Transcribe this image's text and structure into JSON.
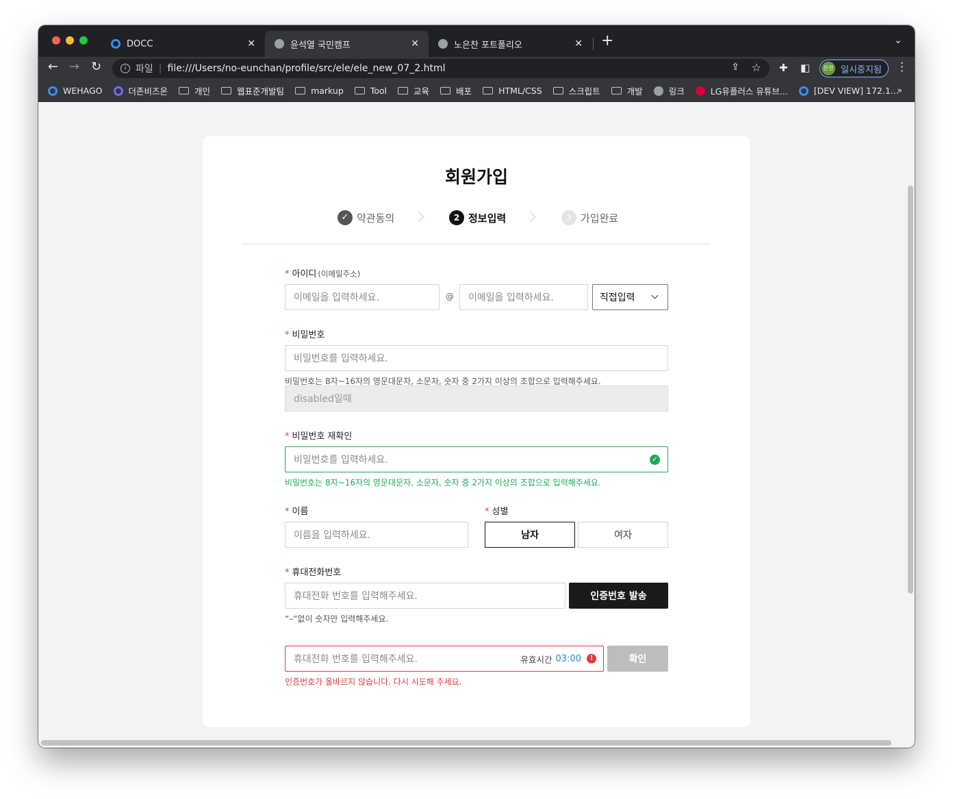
{
  "browser": {
    "tabs": [
      {
        "label": "DOCC",
        "close": "✕"
      },
      {
        "label": "윤석열 국민캠프",
        "close": "✕"
      },
      {
        "label": "노은찬 포트폴리오",
        "close": "✕"
      }
    ],
    "new_tab": "+",
    "tab_menu": "⌄",
    "nav": {
      "back": "←",
      "forward": "→",
      "reload": "↻"
    },
    "address": {
      "info_icon": "i",
      "scheme_label": "파일",
      "url": "file:///Users/no-eunchan/profile/src/ele/ele_new_07_2.html"
    },
    "profile": {
      "avatar": "은찬",
      "label": "일시중지됨"
    },
    "menu": "⋮",
    "bookmarks": [
      {
        "label": "WEHAGO",
        "icon": "ring"
      },
      {
        "label": "더존비즈온",
        "icon": "ring"
      },
      {
        "label": "개인",
        "icon": "folder"
      },
      {
        "label": "웹표준개발팀",
        "icon": "folder"
      },
      {
        "label": "markup",
        "icon": "folder"
      },
      {
        "label": "Tool",
        "icon": "folder"
      },
      {
        "label": "교육",
        "icon": "folder"
      },
      {
        "label": "배포",
        "icon": "folder"
      },
      {
        "label": "HTML/CSS",
        "icon": "folder"
      },
      {
        "label": "스크립트",
        "icon": "folder"
      },
      {
        "label": "개발",
        "icon": "folder"
      },
      {
        "label": "링크",
        "icon": "globe"
      },
      {
        "label": "LG유플러스 유튜브...",
        "icon": "lg"
      },
      {
        "label": "[DEV VIEW] 172.1...",
        "icon": "ring"
      }
    ],
    "bookmarks_more": "»"
  },
  "form": {
    "title": "회원가입",
    "steps": [
      {
        "num": "✓",
        "label": "약관동의"
      },
      {
        "num": "2",
        "label": "정보입력"
      },
      {
        "num": "3",
        "label": "가입완료"
      }
    ],
    "id": {
      "required": "*",
      "label": "아이디",
      "sub": "(이메일주소)",
      "local_placeholder": "이메일을 입력하세요.",
      "at": "@",
      "domain_placeholder": "이메일을 입력하세요.",
      "domain_select": "직접입력"
    },
    "password": {
      "required": "*",
      "label": "비밀번호",
      "placeholder": "비밀번호를 입력하세요.",
      "help": "비밀번호는 8자~16자의 영문대문자, 소문자, 숫자 중 2가지 이상의 조합으로 입력해주세요.",
      "disabled_value": "disabled일때"
    },
    "password_confirm": {
      "required": "*",
      "label": "비밀번호 재확인",
      "placeholder": "비밀번호를 입력하세요.",
      "help": "비밀번호는 8자~16자의 영문대문자, 소문자, 숫자 중 2가지 이상의 조합으로 입력해주세요."
    },
    "name": {
      "required": "*",
      "label": "이름",
      "placeholder": "이름을 입력하세요."
    },
    "gender": {
      "required": "*",
      "label": "성별",
      "male": "남자",
      "female": "여자",
      "selected": "남자"
    },
    "phone": {
      "required": "*",
      "label": "휴대전화번호",
      "placeholder": "휴대전화 번호를 입력해주세요.",
      "send_button": "인증번호 발송",
      "help": "“–“없이 숫자만 입력해주세요."
    },
    "verify": {
      "placeholder": "휴대전화 번호를 입력해주세요.",
      "timer_label": "유효시간",
      "timer_value": "03:00",
      "error_icon": "!",
      "confirm_button": "확인",
      "error": "인증번호가 올바르지 않습니다. 다시 시도해 주세요."
    }
  },
  "colors": {
    "accent_green": "#1fa85a",
    "error_red": "#e23b3b",
    "timer_blue": "#2f7ee0"
  }
}
